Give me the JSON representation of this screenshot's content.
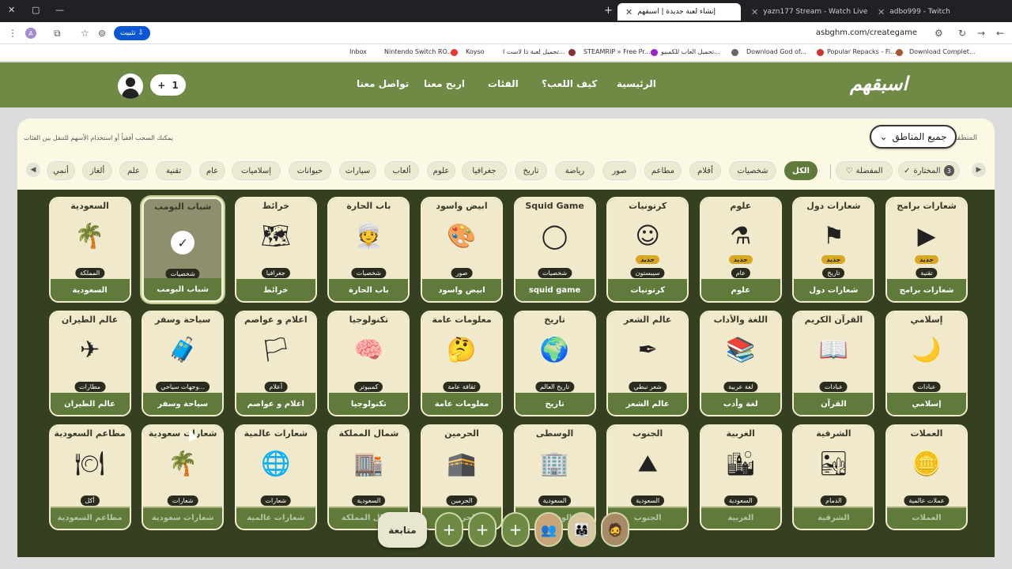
{
  "browser": {
    "tabs": [
      {
        "label": "إنشاء لعبة جديدة | اسبقهم",
        "active": true
      },
      {
        "label": "yazn177 Stream - Watch Live o",
        "active": false
      },
      {
        "label": "adbo999 - Twitch",
        "active": false
      }
    ],
    "new_tab": "+",
    "url": "asbghm.com/creategame",
    "install_label": "تثبيت",
    "profile_initial": "A",
    "bookmarks": [
      "Inbox",
      "Nintendo Switch RO...",
      "Koyso",
      "تحميل لعبة ذا لاست ا...",
      "STEAMRIP » Free Pr...",
      "تحميل العاب للكمبيو...",
      "Download God of...",
      "Popular Repacks - Fi...",
      "Download Complet..."
    ]
  },
  "header": {
    "logo": "اسبقهم",
    "nav": [
      "الرئيسية",
      "كيف اللعب؟",
      "الفئات",
      "اربح معنا",
      "تواصل معنا"
    ],
    "counter_value": "1",
    "counter_plus": "+"
  },
  "filters": {
    "region_label": "المنطقة",
    "region_value": "جميع المناطق",
    "hint": "يمكنك السحب أفقياً أو استخدام الأسهم للتنقل بين الفئات",
    "selected_label": "المختارة",
    "selected_count": "3",
    "favorites_label": "المفضلة",
    "categories": [
      "الكل",
      "شخصيات",
      "أفلام",
      "مطاعم",
      "صور",
      "رياضة",
      "تاريخ",
      "جغرافيا",
      "علوم",
      "ألعاب",
      "سيارات",
      "حيوانات",
      "إسلاميات",
      "عام",
      "تقنية",
      "علم",
      "ألغاز",
      "أنمي"
    ],
    "active_category": "الكل"
  },
  "grid": {
    "rows": [
      [
        {
          "title": "شعارات برامج",
          "badge": "تقنية",
          "name": "شعارات برامج",
          "new": "جديد"
        },
        {
          "title": "شعارات دول",
          "badge": "تاريخ",
          "name": "شعارات دول",
          "new": "جديد"
        },
        {
          "title": "علوم",
          "badge": "عام",
          "name": "علوم",
          "new": "جديد"
        },
        {
          "title": "كرتونيات",
          "badge": "سيبستون",
          "name": "كرتونيات",
          "new": "جديد"
        },
        {
          "title": "Squid Game",
          "badge": "شخصيات",
          "name": "squid game",
          "new": ""
        },
        {
          "title": "ابيض واسود",
          "badge": "صور",
          "name": "ابيض واسود",
          "new": ""
        },
        {
          "title": "باب الحارة",
          "badge": "شخصيات",
          "name": "باب الحارة",
          "new": ""
        },
        {
          "title": "خرائط",
          "badge": "جغرافيا",
          "name": "خرائط",
          "new": ""
        },
        {
          "title": "شباب البومب",
          "badge": "شخصيات",
          "name": "شباب البومب",
          "new": "",
          "selected": true
        },
        {
          "title": "السعودية",
          "badge": "المملكة",
          "name": "السعودية",
          "new": ""
        }
      ],
      [
        {
          "title": "إسلامي",
          "badge": "عبادات",
          "name": "إسلامي",
          "new": ""
        },
        {
          "title": "القرآن الكريم",
          "badge": "عبادات",
          "name": "القرآن",
          "new": ""
        },
        {
          "title": "اللغة والأداب",
          "badge": "لغة عربية",
          "name": "لغة وأدب",
          "new": ""
        },
        {
          "title": "عالم الشعر",
          "badge": "شعر نبطي",
          "name": "عالم الشعر",
          "new": ""
        },
        {
          "title": "تاريخ",
          "badge": "تاريخ العالم",
          "name": "تاريخ",
          "new": ""
        },
        {
          "title": "معلومات عامة",
          "badge": "ثقافة عامة",
          "name": "معلومات عامة",
          "new": ""
        },
        {
          "title": "تكنولوجيا",
          "badge": "كمبيوتر",
          "name": "تكنولوجيا",
          "new": ""
        },
        {
          "title": "اعلام و عواصم",
          "badge": "أعلام",
          "name": "اعلام و عواصم",
          "new": ""
        },
        {
          "title": "سياحة وسفر",
          "badge": "وجهات سياحي...",
          "name": "سياحة وسفر",
          "new": ""
        },
        {
          "title": "عالم الطيران",
          "badge": "مطارات",
          "name": "عالم الطيران",
          "new": ""
        }
      ],
      [
        {
          "title": "العملات",
          "badge": "عملات عالمية",
          "name": "العملات",
          "new": ""
        },
        {
          "title": "الشرقية",
          "badge": "الدمام",
          "name": "الشرقية",
          "new": ""
        },
        {
          "title": "الغربية",
          "badge": "السعودية",
          "name": "الغربية",
          "new": ""
        },
        {
          "title": "الجنوب",
          "badge": "السعودية",
          "name": "الجنوب",
          "new": ""
        },
        {
          "title": "الوسطى",
          "badge": "السعودية",
          "name": "الوسطى",
          "new": ""
        },
        {
          "title": "الحرمين",
          "badge": "الحرمين",
          "name": "الحرمين",
          "new": ""
        },
        {
          "title": "شمال المملكة",
          "badge": "السعودية",
          "name": "شمال المملكة",
          "new": ""
        },
        {
          "title": "شعارات عالمية",
          "badge": "شعارات",
          "name": "شعارات عالمية",
          "new": ""
        },
        {
          "title": "شعارات سعودية",
          "badge": "شعارات",
          "name": "شعارات سعودية",
          "new": ""
        },
        {
          "title": "مطاعم السعودية",
          "badge": "أكل",
          "name": "مطاعم السعودية",
          "new": ""
        }
      ]
    ]
  },
  "bottom": {
    "continue_label": "متابعة",
    "empty_slot": "+"
  },
  "icons": {
    "row1": [
      "app-logo-icon",
      "flag-icon",
      "science-icon",
      "cartoon-icon",
      "squid-icon",
      "palette-icon",
      "man-icon",
      "map-icon",
      "soldier-icon",
      "palm-icon"
    ],
    "row2": [
      "mosque-icon",
      "quran-icon",
      "books-icon",
      "poet-icon",
      "globe-icon",
      "thinker-icon",
      "brain-icon",
      "flags-icon",
      "travel-icon",
      "plane-icon"
    ],
    "row3": [
      "coins-icon",
      "dammam-icon",
      "jeddah-icon",
      "south-icon",
      "riyadh-icon",
      "haram-icon",
      "north-icon",
      "world-logos-icon",
      "saudi-logos-icon",
      "food-icon"
    ]
  },
  "colors": {
    "brand": "#6f8a45",
    "grid_bg": "#34401f",
    "panel": "#fbf8e4",
    "accent_new": "#d9a720"
  }
}
